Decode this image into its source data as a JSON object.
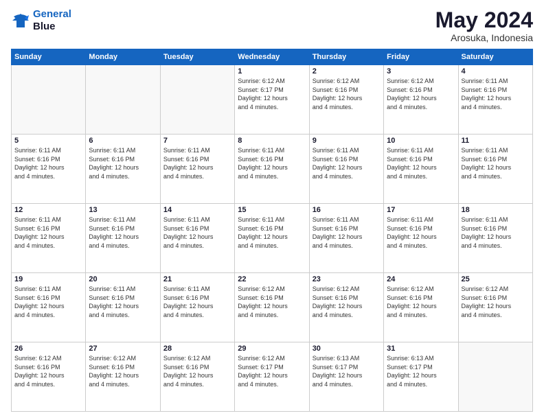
{
  "logo": {
    "line1": "General",
    "line2": "Blue"
  },
  "title": "May 2024",
  "location": "Arosuka, Indonesia",
  "days_header": [
    "Sunday",
    "Monday",
    "Tuesday",
    "Wednesday",
    "Thursday",
    "Friday",
    "Saturday"
  ],
  "weeks": [
    [
      {
        "day": "",
        "info": ""
      },
      {
        "day": "",
        "info": ""
      },
      {
        "day": "",
        "info": ""
      },
      {
        "day": "1",
        "info": "Sunrise: 6:12 AM\nSunset: 6:17 PM\nDaylight: 12 hours\nand 4 minutes."
      },
      {
        "day": "2",
        "info": "Sunrise: 6:12 AM\nSunset: 6:16 PM\nDaylight: 12 hours\nand 4 minutes."
      },
      {
        "day": "3",
        "info": "Sunrise: 6:12 AM\nSunset: 6:16 PM\nDaylight: 12 hours\nand 4 minutes."
      },
      {
        "day": "4",
        "info": "Sunrise: 6:11 AM\nSunset: 6:16 PM\nDaylight: 12 hours\nand 4 minutes."
      }
    ],
    [
      {
        "day": "5",
        "info": "Sunrise: 6:11 AM\nSunset: 6:16 PM\nDaylight: 12 hours\nand 4 minutes."
      },
      {
        "day": "6",
        "info": "Sunrise: 6:11 AM\nSunset: 6:16 PM\nDaylight: 12 hours\nand 4 minutes."
      },
      {
        "day": "7",
        "info": "Sunrise: 6:11 AM\nSunset: 6:16 PM\nDaylight: 12 hours\nand 4 minutes."
      },
      {
        "day": "8",
        "info": "Sunrise: 6:11 AM\nSunset: 6:16 PM\nDaylight: 12 hours\nand 4 minutes."
      },
      {
        "day": "9",
        "info": "Sunrise: 6:11 AM\nSunset: 6:16 PM\nDaylight: 12 hours\nand 4 minutes."
      },
      {
        "day": "10",
        "info": "Sunrise: 6:11 AM\nSunset: 6:16 PM\nDaylight: 12 hours\nand 4 minutes."
      },
      {
        "day": "11",
        "info": "Sunrise: 6:11 AM\nSunset: 6:16 PM\nDaylight: 12 hours\nand 4 minutes."
      }
    ],
    [
      {
        "day": "12",
        "info": "Sunrise: 6:11 AM\nSunset: 6:16 PM\nDaylight: 12 hours\nand 4 minutes."
      },
      {
        "day": "13",
        "info": "Sunrise: 6:11 AM\nSunset: 6:16 PM\nDaylight: 12 hours\nand 4 minutes."
      },
      {
        "day": "14",
        "info": "Sunrise: 6:11 AM\nSunset: 6:16 PM\nDaylight: 12 hours\nand 4 minutes."
      },
      {
        "day": "15",
        "info": "Sunrise: 6:11 AM\nSunset: 6:16 PM\nDaylight: 12 hours\nand 4 minutes."
      },
      {
        "day": "16",
        "info": "Sunrise: 6:11 AM\nSunset: 6:16 PM\nDaylight: 12 hours\nand 4 minutes."
      },
      {
        "day": "17",
        "info": "Sunrise: 6:11 AM\nSunset: 6:16 PM\nDaylight: 12 hours\nand 4 minutes."
      },
      {
        "day": "18",
        "info": "Sunrise: 6:11 AM\nSunset: 6:16 PM\nDaylight: 12 hours\nand 4 minutes."
      }
    ],
    [
      {
        "day": "19",
        "info": "Sunrise: 6:11 AM\nSunset: 6:16 PM\nDaylight: 12 hours\nand 4 minutes."
      },
      {
        "day": "20",
        "info": "Sunrise: 6:11 AM\nSunset: 6:16 PM\nDaylight: 12 hours\nand 4 minutes."
      },
      {
        "day": "21",
        "info": "Sunrise: 6:11 AM\nSunset: 6:16 PM\nDaylight: 12 hours\nand 4 minutes."
      },
      {
        "day": "22",
        "info": "Sunrise: 6:12 AM\nSunset: 6:16 PM\nDaylight: 12 hours\nand 4 minutes."
      },
      {
        "day": "23",
        "info": "Sunrise: 6:12 AM\nSunset: 6:16 PM\nDaylight: 12 hours\nand 4 minutes."
      },
      {
        "day": "24",
        "info": "Sunrise: 6:12 AM\nSunset: 6:16 PM\nDaylight: 12 hours\nand 4 minutes."
      },
      {
        "day": "25",
        "info": "Sunrise: 6:12 AM\nSunset: 6:16 PM\nDaylight: 12 hours\nand 4 minutes."
      }
    ],
    [
      {
        "day": "26",
        "info": "Sunrise: 6:12 AM\nSunset: 6:16 PM\nDaylight: 12 hours\nand 4 minutes."
      },
      {
        "day": "27",
        "info": "Sunrise: 6:12 AM\nSunset: 6:16 PM\nDaylight: 12 hours\nand 4 minutes."
      },
      {
        "day": "28",
        "info": "Sunrise: 6:12 AM\nSunset: 6:16 PM\nDaylight: 12 hours\nand 4 minutes."
      },
      {
        "day": "29",
        "info": "Sunrise: 6:12 AM\nSunset: 6:17 PM\nDaylight: 12 hours\nand 4 minutes."
      },
      {
        "day": "30",
        "info": "Sunrise: 6:13 AM\nSunset: 6:17 PM\nDaylight: 12 hours\nand 4 minutes."
      },
      {
        "day": "31",
        "info": "Sunrise: 6:13 AM\nSunset: 6:17 PM\nDaylight: 12 hours\nand 4 minutes."
      },
      {
        "day": "",
        "info": ""
      }
    ]
  ]
}
